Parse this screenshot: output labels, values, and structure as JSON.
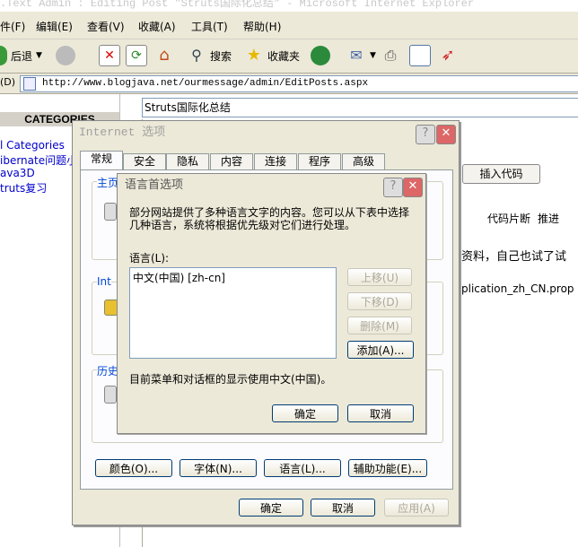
{
  "window": {
    "title": ".Text Admin : Editing Post \"Struts国际化总结\" - Microsoft Internet Explorer"
  },
  "menubar": {
    "items": [
      "件(F)",
      "编辑(E)",
      "查看(V)",
      "收藏(A)",
      "工具(T)",
      "帮助(H)"
    ]
  },
  "toolbar": {
    "back_label": "后退",
    "search_label": "搜索",
    "favorites_label": "收藏夹"
  },
  "address": {
    "label": "(D)",
    "url": "http://www.blogjava.net/ourmessage/admin/EditPosts.aspx"
  },
  "sidebar": {
    "heading": "CATEGORIES",
    "links": [
      "l Categories",
      "ibernate问题小",
      "ava3D",
      "truts复习"
    ]
  },
  "post": {
    "title": "Struts国际化总结",
    "toolbar_insert_code": "插入代码",
    "toolbar_snippet": "代码片断",
    "toolbar_recommend": "推进",
    "body_line1": "资料，自己也试了试",
    "body_line2": "plication_zh_CN.prop"
  },
  "internet_options": {
    "title": "Internet 选项",
    "tabs": [
      "常规",
      "安全",
      "隐私",
      "内容",
      "连接",
      "程序",
      "高级"
    ],
    "groups": [
      "主页",
      "Int",
      "历史"
    ],
    "buttons": {
      "colors": "颜色(O)...",
      "fonts": "字体(N)...",
      "languages": "语言(L)...",
      "accessibility": "辅助功能(E)..."
    },
    "ok": "确定",
    "cancel": "取消",
    "apply": "应用(A)"
  },
  "language_dialog": {
    "title": "语言首选项",
    "description": "部分网站提供了多种语言文字的内容。您可以从下表中选择几种语言，系统将根据优先级对它们进行处理。",
    "list_label": "语言(L):",
    "languages": [
      "中文(中国) [zh-cn]"
    ],
    "move_up": "上移(U)",
    "move_down": "下移(D)",
    "remove": "删除(M)",
    "add": "添加(A)...",
    "menu_info": "目前菜单和对话框的显示使用中文(中国)。",
    "ok": "确定",
    "cancel": "取消"
  }
}
